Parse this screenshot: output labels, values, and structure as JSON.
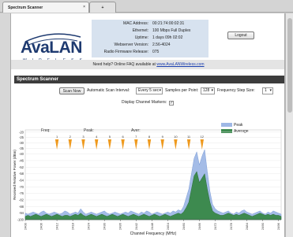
{
  "browser": {
    "tabs": [
      {
        "label": "Spectrum Scanner",
        "close": "×"
      },
      {
        "label": "+"
      }
    ]
  },
  "header": {
    "logo_text": "AvaLAN",
    "logo_sub": "WIRELESS",
    "info": [
      {
        "label": "MAC Address:",
        "value": "00:21:74:00:02:31"
      },
      {
        "label": "Ethernet:",
        "value": "100 Mbps Full Duplex"
      },
      {
        "label": "Uptime:",
        "value": "1 days 09h 02:02"
      },
      {
        "label": "Webserver Version:",
        "value": "2.56-4024"
      },
      {
        "label": "Radio Firmware Release:",
        "value": "075"
      }
    ],
    "logout_label": "Logout"
  },
  "help": {
    "prefix": "Need help?   Online FAQ available at",
    "link": "www.AvaLANWireless.com"
  },
  "section_title": "Spectrum Scanner",
  "controls": {
    "scan_now": "Scan Now",
    "interval_label": "Automatic Scan Interval:",
    "interval_value": "Every 5 sec",
    "samples_label": "Samples per Point:",
    "samples_value": "128",
    "step_label": "Frequency Step Size:",
    "step_value": "1",
    "markers_label": "Display Channel Markers:",
    "markers_checked": "✓"
  },
  "chart_data": {
    "type": "area",
    "top_labels": [
      "Freq:",
      "Peak:",
      "Aver:"
    ],
    "legend": [
      {
        "name": "Peak",
        "color": "#9fb8e6"
      },
      {
        "name": "Average",
        "color": "#3d8a4f"
      }
    ],
    "channel_markers": [
      "1",
      "2",
      "3",
      "4",
      "5",
      "6",
      "7",
      "8",
      "9",
      "10",
      "11",
      "12"
    ],
    "marker_color": "#ef9a1e",
    "ylabel": "Received Relative Power (dBm)",
    "xlabel": "Channel Frequency (MHz)",
    "ylim": [
      -100,
      -18
    ],
    "yticks": [
      -20,
      -25,
      -30,
      -35,
      -40,
      -46,
      -52,
      -58,
      -64,
      -70,
      -76,
      -82,
      -88,
      -94,
      -100
    ],
    "x": [
      2400,
      2401,
      2402,
      2403,
      2404,
      2405,
      2406,
      2407,
      2408,
      2409,
      2410,
      2411,
      2412,
      2413,
      2414,
      2415,
      2416,
      2417,
      2418,
      2419,
      2420,
      2421,
      2422,
      2423,
      2424,
      2425,
      2426,
      2427,
      2428,
      2429,
      2430,
      2431,
      2432,
      2433,
      2434,
      2435,
      2436,
      2437,
      2438,
      2439,
      2440,
      2441,
      2442,
      2443,
      2444,
      2445,
      2446,
      2447,
      2448,
      2449,
      2450,
      2451,
      2452,
      2453,
      2454,
      2455,
      2456,
      2457,
      2458,
      2459,
      2460,
      2461,
      2462,
      2463,
      2464,
      2465,
      2466,
      2467,
      2468,
      2469,
      2470,
      2471,
      2472,
      2473,
      2474,
      2475,
      2476,
      2477,
      2478,
      2479,
      2480,
      2481,
      2482,
      2483,
      2484,
      2485,
      2486,
      2487,
      2488,
      2489,
      2490,
      2491,
      2492,
      2493,
      2494,
      2495,
      2496,
      2497
    ],
    "xticks": [
      2400,
      2406,
      2412,
      2418,
      2424,
      2430,
      2436,
      2442,
      2448,
      2454,
      2460,
      2466,
      2472,
      2478,
      2484,
      2490,
      2496
    ],
    "series": [
      {
        "name": "Peak",
        "values": [
          -94,
          -95,
          -94,
          -93,
          -94,
          -95,
          -93,
          -92,
          -94,
          -95,
          -94,
          -93,
          -94,
          -95,
          -94,
          -92,
          -93,
          -95,
          -94,
          -93,
          -94,
          -90,
          -93,
          -95,
          -94,
          -93,
          -94,
          -95,
          -94,
          -93,
          -92,
          -94,
          -95,
          -94,
          -93,
          -94,
          -95,
          -94,
          -93,
          -94,
          -92,
          -93,
          -94,
          -95,
          -93,
          -94,
          -92,
          -93,
          -95,
          -94,
          -93,
          -94,
          -95,
          -94,
          -93,
          -94,
          -92,
          -93,
          -91,
          -92,
          -88,
          -80,
          -72,
          -58,
          -44,
          -38,
          -50,
          -42,
          -36,
          -56,
          -74,
          -86,
          -90,
          -92,
          -93,
          -94,
          -93,
          -92,
          -94,
          -95,
          -93,
          -94,
          -92,
          -91,
          -93,
          -94,
          -95,
          -94,
          -93,
          -92,
          -94,
          -95,
          -93,
          -94,
          -92,
          -93,
          -94,
          -95
        ]
      },
      {
        "name": "Average",
        "values": [
          -97,
          -96,
          -97,
          -96,
          -95,
          -96,
          -97,
          -96,
          -95,
          -96,
          -97,
          -96,
          -95,
          -96,
          -97,
          -96,
          -96,
          -97,
          -96,
          -95,
          -96,
          -94,
          -96,
          -97,
          -96,
          -95,
          -96,
          -97,
          -96,
          -95,
          -96,
          -97,
          -96,
          -95,
          -96,
          -97,
          -96,
          -95,
          -96,
          -97,
          -96,
          -95,
          -96,
          -97,
          -96,
          -95,
          -96,
          -97,
          -96,
          -95,
          -96,
          -97,
          -96,
          -95,
          -96,
          -97,
          -96,
          -95,
          -94,
          -95,
          -93,
          -89,
          -84,
          -72,
          -60,
          -56,
          -66,
          -62,
          -58,
          -72,
          -84,
          -92,
          -94,
          -95,
          -96,
          -96,
          -95,
          -94,
          -95,
          -96,
          -95,
          -96,
          -95,
          -94,
          -95,
          -96,
          -97,
          -96,
          -95,
          -94,
          -95,
          -96,
          -95,
          -96,
          -95,
          -96,
          -96,
          -97
        ]
      }
    ]
  }
}
